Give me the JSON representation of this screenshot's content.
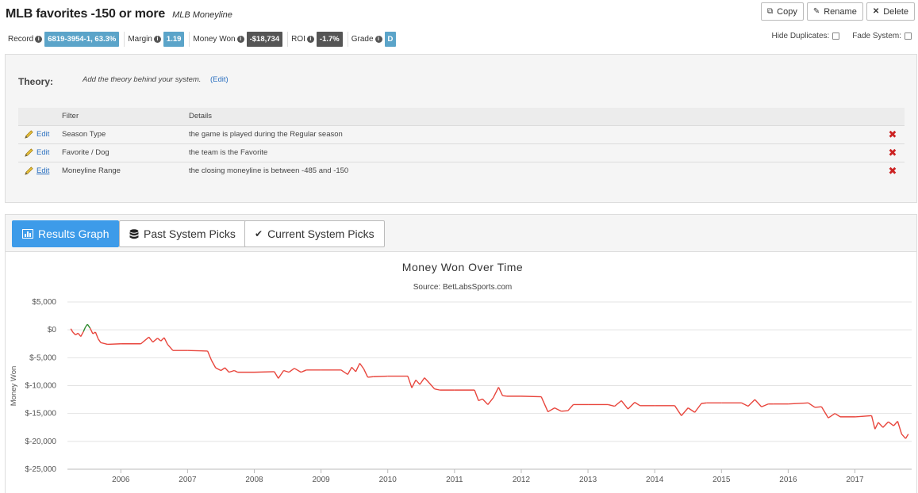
{
  "header": {
    "title": "MLB favorites -150 or more",
    "subtitle": "MLB Moneyline",
    "buttons": [
      {
        "label": "Copy",
        "icon": "copy-icon"
      },
      {
        "label": "Rename",
        "icon": "pencil-icon"
      },
      {
        "label": "Delete",
        "icon": "close-icon"
      }
    ]
  },
  "stats": {
    "record_label": "Record",
    "record_value": "6819-3954-1, 63.3%",
    "margin_label": "Margin",
    "margin_value": "1.19",
    "money_won_label": "Money Won",
    "money_won_value": "-$18,734",
    "roi_label": "ROI",
    "roi_value": "-1.7%",
    "grade_label": "Grade",
    "grade_value": "D",
    "info_glyph": "i"
  },
  "options": {
    "hide_duplicates_label": "Hide Duplicates:",
    "fade_system_label": "Fade System:"
  },
  "theory": {
    "label": "Theory:",
    "text": "Add the theory behind your system.",
    "edit_label": "(Edit)"
  },
  "filters": {
    "header_filter": "Filter",
    "header_details": "Details",
    "edit_label": "Edit",
    "remove_glyph": "✖",
    "rows": [
      {
        "filter": "Season Type",
        "details": "the game is played during the Regular season"
      },
      {
        "filter": "Favorite / Dog",
        "details": "the team is the Favorite"
      },
      {
        "filter": "Moneyline Range",
        "details": "the closing moneyline is between -485 and -150"
      }
    ]
  },
  "tabs": [
    {
      "label": "Results Graph",
      "icon": "bar-chart-icon",
      "active": true
    },
    {
      "label": "Past System Picks",
      "icon": "database-icon",
      "active": false
    },
    {
      "label": "Current System Picks",
      "icon": "checkmark-icon",
      "active": false
    }
  ],
  "chart_data": {
    "type": "line",
    "title": "Money Won Over Time",
    "subtitle": "Source: BetLabsSports.com",
    "ylabel": "Money Won",
    "xlabel": "",
    "ylim": [
      -25000,
      5000
    ],
    "yticks": [
      5000,
      0,
      -5000,
      -10000,
      -15000,
      -20000,
      -25000
    ],
    "ytick_labels": [
      "$5,000",
      "$0",
      "$-5,000",
      "$-10,000",
      "$-15,000",
      "$-20,000",
      "$-25,000"
    ],
    "xlim": [
      2005.2,
      2017.85
    ],
    "xticks": [
      2006,
      2007,
      2008,
      2009,
      2010,
      2011,
      2012,
      2013,
      2014,
      2015,
      2016,
      2017
    ],
    "xtick_labels": [
      "2006",
      "2007",
      "2008",
      "2009",
      "2010",
      "2011",
      "2012",
      "2013",
      "2014",
      "2015",
      "2016",
      "2017"
    ],
    "grid": true,
    "colors": {
      "positive": "#2e8b2e",
      "negative": "#e8453c"
    },
    "x": [
      2005.25,
      2005.28,
      2005.32,
      2005.36,
      2005.4,
      2005.44,
      2005.47,
      2005.5,
      2005.54,
      2005.58,
      2005.62,
      2005.66,
      2005.7,
      2005.8,
      2006.0,
      2006.3,
      2006.42,
      2006.48,
      2006.55,
      2006.6,
      2006.65,
      2006.7,
      2006.78,
      2007.0,
      2007.3,
      2007.36,
      2007.42,
      2007.5,
      2007.56,
      2007.62,
      2007.7,
      2007.75,
      2008.0,
      2008.3,
      2008.36,
      2008.44,
      2008.52,
      2008.6,
      2008.7,
      2008.78,
      2009.0,
      2009.3,
      2009.4,
      2009.46,
      2009.52,
      2009.58,
      2009.64,
      2009.7,
      2009.78,
      2010.0,
      2010.3,
      2010.36,
      2010.42,
      2010.48,
      2010.55,
      2010.62,
      2010.7,
      2010.78,
      2011.0,
      2011.3,
      2011.36,
      2011.42,
      2011.5,
      2011.58,
      2011.66,
      2011.72,
      2011.78,
      2012.0,
      2012.3,
      2012.4,
      2012.5,
      2012.6,
      2012.7,
      2012.78,
      2013.0,
      2013.3,
      2013.4,
      2013.5,
      2013.6,
      2013.7,
      2013.78,
      2014.0,
      2014.3,
      2014.4,
      2014.5,
      2014.6,
      2014.7,
      2014.78,
      2015.0,
      2015.3,
      2015.4,
      2015.5,
      2015.6,
      2015.7,
      2015.78,
      2016.0,
      2016.3,
      2016.4,
      2016.5,
      2016.6,
      2016.7,
      2016.78,
      2017.0,
      2017.25,
      2017.3,
      2017.35,
      2017.42,
      2017.5,
      2017.58,
      2017.64,
      2017.7,
      2017.76,
      2017.8
    ],
    "y": [
      200,
      -400,
      -900,
      -600,
      -1200,
      -300,
      500,
      1000,
      300,
      -700,
      -400,
      -1600,
      -2300,
      -2600,
      -2500,
      -2500,
      -1300,
      -2200,
      -1500,
      -2000,
      -1400,
      -2600,
      -3700,
      -3700,
      -3800,
      -5500,
      -6800,
      -7300,
      -6800,
      -7600,
      -7300,
      -7600,
      -7600,
      -7500,
      -8700,
      -7300,
      -7600,
      -6900,
      -7600,
      -7200,
      -7200,
      -7200,
      -8000,
      -6700,
      -7500,
      -6000,
      -7000,
      -8500,
      -8400,
      -8300,
      -8300,
      -10400,
      -9000,
      -9800,
      -8600,
      -9500,
      -10600,
      -10800,
      -10800,
      -10800,
      -12700,
      -12400,
      -13400,
      -12200,
      -10300,
      -11800,
      -11900,
      -11900,
      -12000,
      -14700,
      -14000,
      -14600,
      -14500,
      -13400,
      -13400,
      -13400,
      -13700,
      -12700,
      -14200,
      -13000,
      -13600,
      -13600,
      -13600,
      -15400,
      -14000,
      -14800,
      -13200,
      -13100,
      -13100,
      -13100,
      -13700,
      -12500,
      -13800,
      -13300,
      -13300,
      -13300,
      -13100,
      -13900,
      -13800,
      -15800,
      -15000,
      -15600,
      -15600,
      -15400,
      -17800,
      -16600,
      -17500,
      -16500,
      -17200,
      -16400,
      -18700,
      -19500,
      -18700
    ]
  }
}
